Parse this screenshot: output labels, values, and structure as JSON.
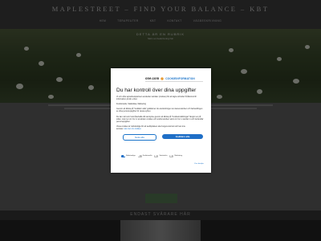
{
  "site": {
    "title": "MAPLESTREET – FIND YOUR BALANCE – KBT",
    "nav": [
      "HEM",
      "TERAPEUTER",
      "KBT",
      "KONTAKT",
      "VÄGBESKRIVNING"
    ],
    "hero_subtitle": "DETTA ÄR EN RUBRIK",
    "hero_subtitle2": "Skriv en beskrivning här",
    "footer_heading": "ENDAST SVÅRARE HÄR"
  },
  "cookie_dialog": {
    "brand": "one.com",
    "brand_product": "COOKIEINFORMATION",
    "title": "Du har kontroll över dina uppgifter",
    "intro": "Vi och våra samarbetspartners använder tekniker (cookies) för att lagra och/eller få åtkomst till information på din enhet.",
    "purposes": "Funktionella, Statistiska, Marketing",
    "paragraph1": "Genom att klicka på \"Godkänn alla\" godkänner du användningen av dessa tekniker och behandlingen av dina personuppgifter för dessa syften.",
    "paragraph2": "Du kan när som helst återkalla ditt samtycke genom att klicka på \"Cookieinställningar\" längst ner på sidan. Läs mer om hur vi använder cookies och andra tekniker samt om hur vi samlar in och behandlar personuppgifter.",
    "paragraph3": "Vissa cookies är nödvändiga för att webbplatsen ska fungera korrekt och kan inte avvisas.",
    "link": "Läs mer om cookies",
    "deny_button": "Neka alla",
    "accept_button": "Godkänn alla",
    "preferences": [
      {
        "label": "Nödvändiga",
        "on": true
      },
      {
        "label": "Funktionella",
        "on": false
      },
      {
        "label": "Statistiska",
        "on": false
      },
      {
        "label": "Marketing",
        "on": false
      }
    ],
    "details_link": "Visa detaljer",
    "colors": {
      "accent": "#1f6fc7"
    }
  }
}
